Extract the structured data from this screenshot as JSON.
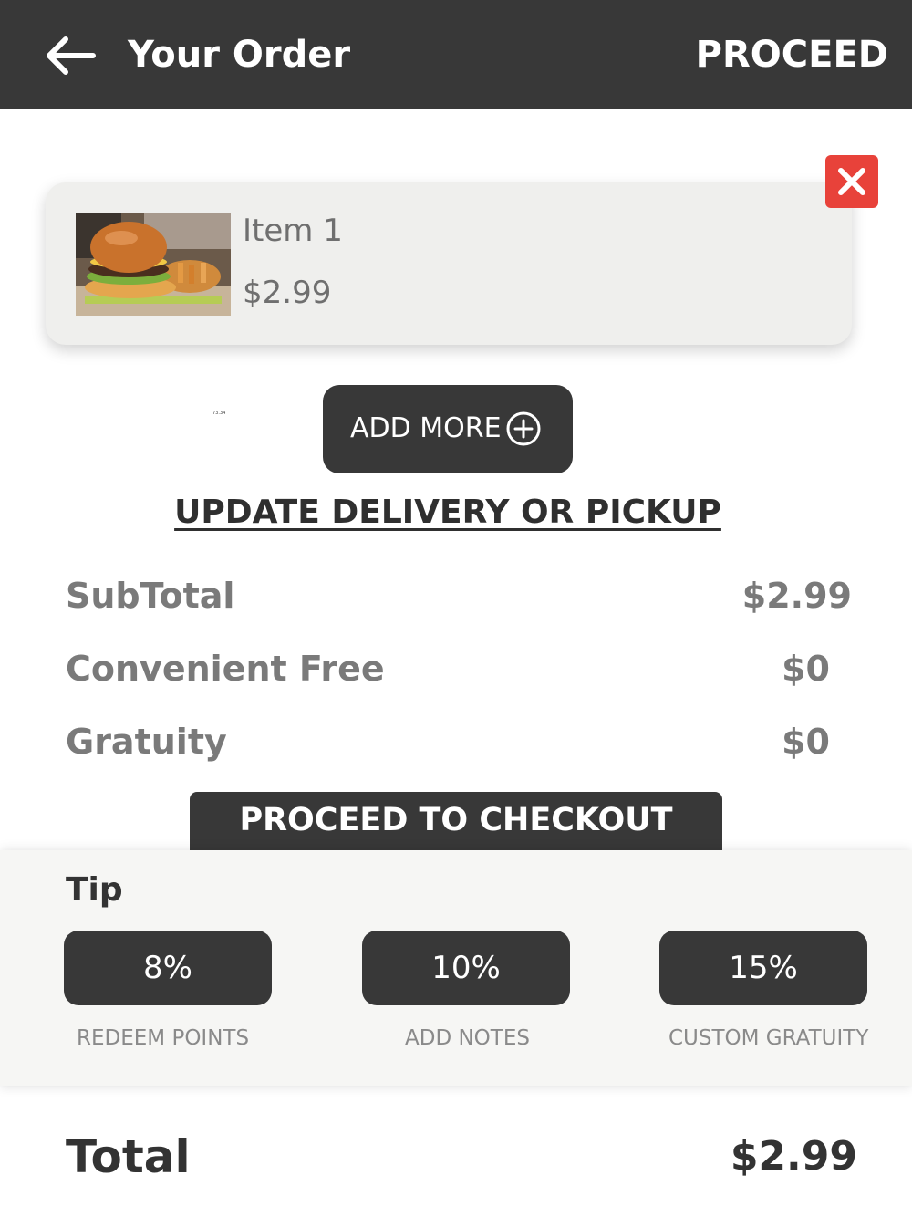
{
  "header": {
    "back_icon": "arrow-left-icon",
    "title": "Your Order",
    "proceed_label": "PROCEED"
  },
  "cart": {
    "items": [
      {
        "name": "Item 1",
        "price": "$2.99",
        "image": "burger-photo"
      }
    ],
    "remove_icon": "close-icon",
    "remove_color": "#e8423a"
  },
  "tiny_note": "73.34",
  "actions": {
    "add_more_label": "ADD MORE",
    "add_more_icon": "plus-circle-icon",
    "update_link": "UPDATE DELIVERY OR PICKUP"
  },
  "summary": {
    "subtotal_label": "SubTotal",
    "subtotal_value": "$2.99",
    "fee_label": "Convenient Free",
    "fee_value": "$0",
    "gratuity_label": "Gratuity",
    "gratuity_value": "$0"
  },
  "checkout_label": "PROCEED TO CHECKOUT",
  "tip": {
    "title": "Tip",
    "options": [
      "8%",
      "10%",
      "15%"
    ],
    "links": [
      "REDEEM POINTS",
      "ADD NOTES",
      "CUSTOM GRATUITY"
    ]
  },
  "total": {
    "label": "Total",
    "value": "$2.99"
  },
  "colors": {
    "header_bg": "#383838",
    "button_bg": "#383838",
    "card_bg": "#efefed"
  }
}
